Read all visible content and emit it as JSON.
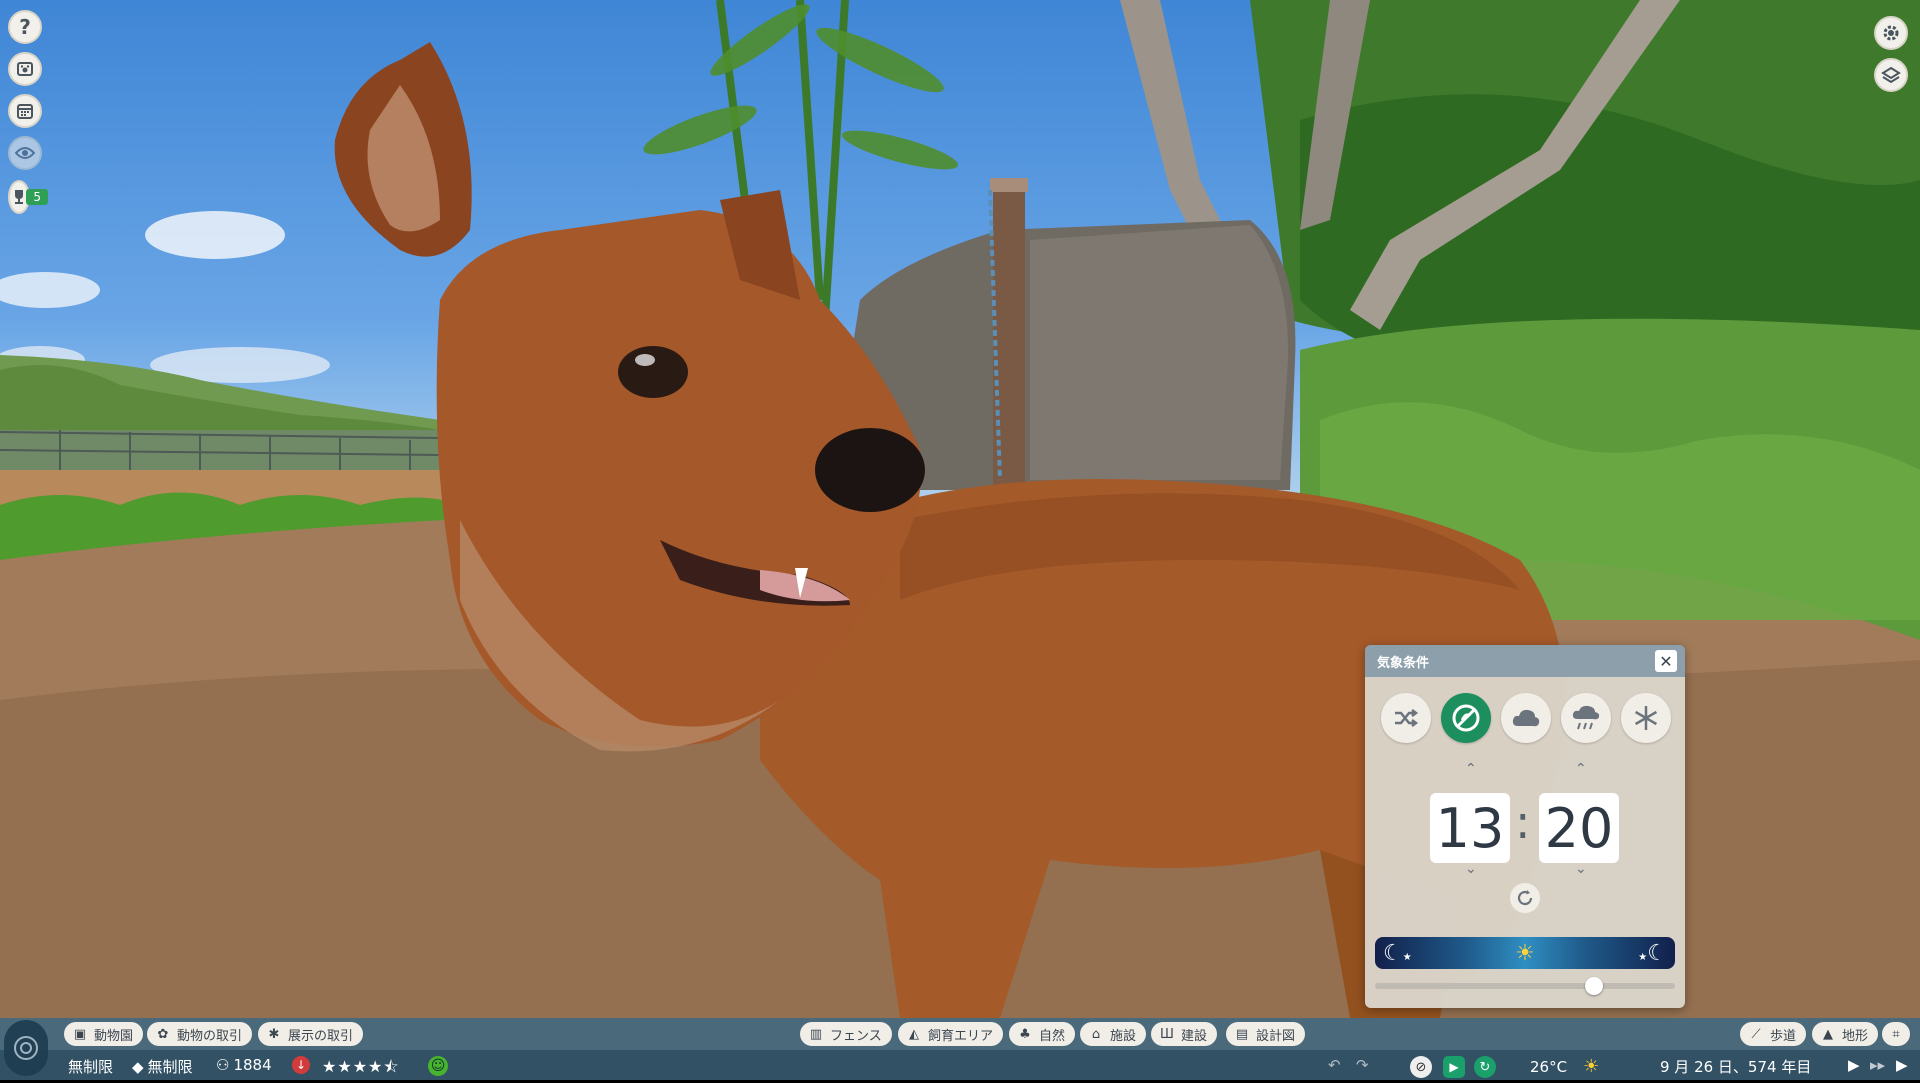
{
  "left_toolbar": {
    "help_icon_glyph": "?",
    "quest_count": "5"
  },
  "weather_panel": {
    "title": "気象条件",
    "close_glyph": "✕",
    "hour": "13",
    "minute": "20",
    "colon": ":",
    "options": [
      "random",
      "clear",
      "cloudy",
      "rain",
      "snow"
    ],
    "active_option": "clear",
    "time_of_day_fraction": 0.73,
    "accent_color": "#1d8f5e"
  },
  "top_bar": {
    "left_buttons": [
      "動物園",
      "動物の取引",
      "展示の取引"
    ],
    "center_buttons": [
      "フェンス",
      "飼育エリア",
      "自然",
      "施設",
      "建設",
      "設計図"
    ],
    "right_buttons": [
      "歩道",
      "地形"
    ]
  },
  "status_bar": {
    "money": "無制限",
    "research": "無制限",
    "guests": "1884",
    "rating_stars": 4.5,
    "temperature": "26°C",
    "date": "9 月 26 日、574 年目"
  }
}
